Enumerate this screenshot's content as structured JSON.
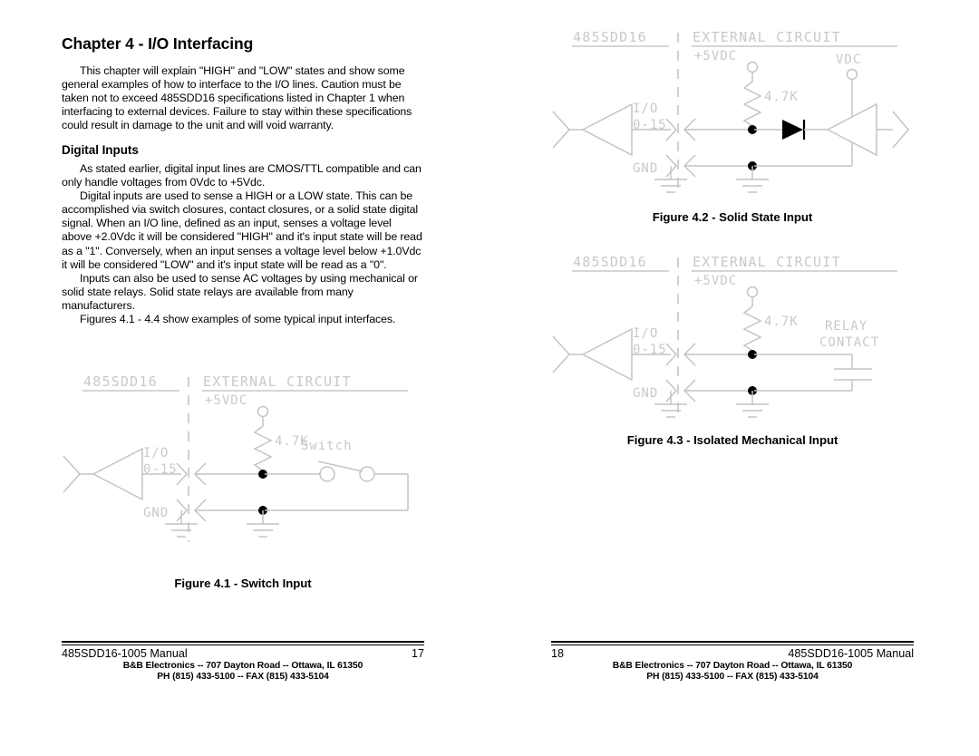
{
  "document": {
    "title": "485SDD16-1005 Manual",
    "chapter_title": "Chapter 4 - I/O Interfacing"
  },
  "left_page": {
    "chapter_title": "Chapter 4 - I/O Interfacing",
    "intro_paragraph": "This chapter will explain \"HIGH\" and \"LOW\" states and show some general examples of how to interface to the I/O lines.  Caution must be taken not to exceed 485SDD16 specifications listed in Chapter 1 when interfacing to external devices.  Failure to stay within these specifications could result in damage to the unit and will void warranty.",
    "section_title": "Digital Inputs",
    "paragraph_1": "As stated earlier, digital input lines are CMOS/TTL compatible and can only handle voltages from 0Vdc to +5Vdc.",
    "paragraph_2": "Digital inputs are used to sense a HIGH or a LOW state.  This can be accomplished via switch closures, contact closures, or a solid state digital signal.  When an I/O line, defined as an input, senses a voltage level above +2.0Vdc it will be considered \"HIGH\" and it's input state will be read as a \"1\".  Conversely, when an input senses a voltage level below +1.0Vdc it will be considered \"LOW\" and it's input state will be read as a \"0\".",
    "paragraph_3": "Inputs can also be used to sense AC voltages by using mechanical or solid state relays.  Solid state relays are available from many manufacturers.",
    "paragraph_4": "Figures 4.1 - 4.4 show examples of some typical input interfaces.",
    "figure_caption": "Figure 4.1 - Switch Input",
    "footer": {
      "manual": "485SDD16-1005 Manual",
      "page_number": "17",
      "address": "B&B Electronics  --  707 Dayton Road  --  Ottawa, IL  61350",
      "phone": "PH (815) 433-5100  --  FAX (815) 433-5104"
    }
  },
  "right_page": {
    "figure_2_caption": "Figure 4.2 - Solid State Input",
    "figure_3_caption": "Figure 4.3 - Isolated Mechanical Input",
    "footer": {
      "manual": "485SDD16-1005 Manual",
      "page_number": "18",
      "address": "B&B Electronics  --  707 Dayton Road  --  Ottawa, IL  61350",
      "phone": "PH (815) 433-5100  --  FAX (815) 433-5104"
    }
  },
  "figure_4_1": {
    "label_device": "485SDD16",
    "label_external": "EXTERNAL CIRCUIT",
    "label_supply": "+5VDC",
    "label_resistor": "4.7K",
    "label_io": "I/O",
    "label_io_range": "0-15",
    "label_gnd": "GND",
    "label_switch": "Switch"
  },
  "figure_4_2": {
    "label_device": "485SDD16",
    "label_external": "EXTERNAL CIRCUIT",
    "label_supply": "+5VDC",
    "label_resistor": "4.7K",
    "label_io": "I/O",
    "label_io_range": "0-15",
    "label_gnd": "GND",
    "label_vdc": "VDC"
  },
  "figure_4_3": {
    "label_device": "485SDD16",
    "label_external": "EXTERNAL CIRCUIT",
    "label_supply": "+5VDC",
    "label_resistor": "4.7K",
    "label_io": "I/O",
    "label_io_range": "0-15",
    "label_gnd": "GND",
    "label_relay_line1": "RELAY",
    "label_relay_line2": "CONTACT"
  },
  "colors": {
    "text": "#000000",
    "schematic_line": "#c4c4c4",
    "schematic_text": "#c9c9c9",
    "node": "#000000"
  }
}
